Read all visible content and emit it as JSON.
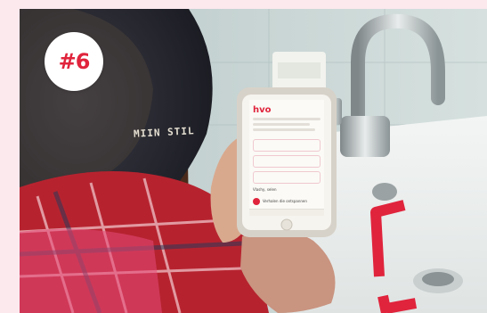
{
  "badge": {
    "label": "#6"
  },
  "bottle": {
    "label": "MIIN STIL"
  },
  "phone": {
    "app_logo": "hvo",
    "section_label": "Vlashy, selen",
    "status_text": "Verhalen die ontspannen"
  },
  "colors": {
    "accent": "#e0243c",
    "background": "#fbe9ee"
  }
}
